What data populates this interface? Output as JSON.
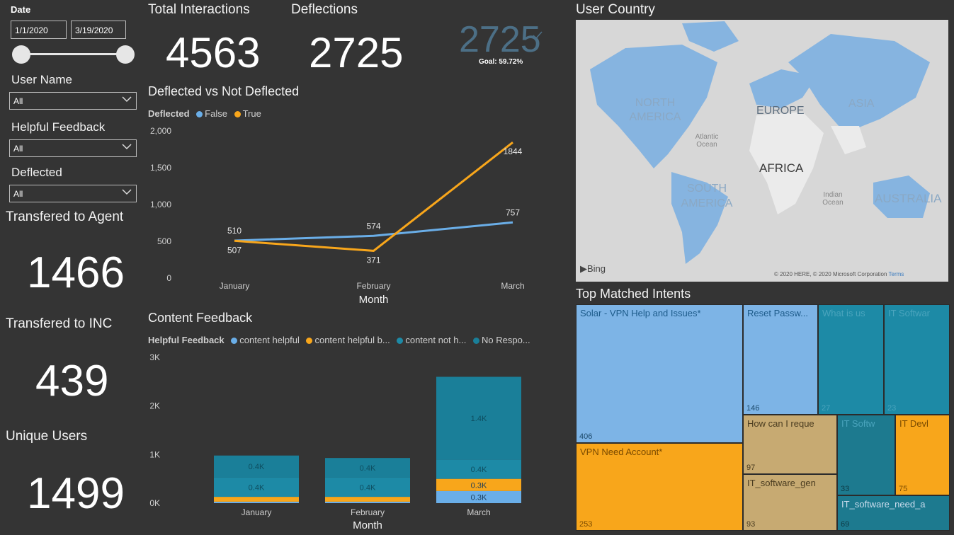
{
  "filters": {
    "date_label": "Date",
    "date_start": "1/1/2020",
    "date_end": "3/19/2020",
    "user_name": {
      "label": "User Name",
      "value": "All"
    },
    "helpful_feedback": {
      "label": "Helpful Feedback",
      "value": "All"
    },
    "deflected": {
      "label": "Deflected",
      "value": "All"
    }
  },
  "cards": {
    "transferred_agent": {
      "label": "Transfered to Agent",
      "value": "1466"
    },
    "transferred_inc": {
      "label": "Transfered to INC",
      "value": "439"
    },
    "unique_users": {
      "label": "Unique Users",
      "value": "1499"
    },
    "total_interactions": {
      "label": "Total Interactions",
      "value": "4563"
    },
    "deflections": {
      "label": "Deflections",
      "value": "2725"
    },
    "kpi": {
      "value": "2725",
      "goal": "Goal: 59.72%"
    }
  },
  "colors": {
    "blue": "#6aaee8",
    "orange": "#f8a61b",
    "teal": "#1d8aa6",
    "teal2": "#1a7f99"
  },
  "chart_data": [
    {
      "type": "line",
      "title": "Deflected vs Not Deflected",
      "legend_title": "Deflected",
      "xlabel": "Month",
      "ylabel": "",
      "categories": [
        "January",
        "February",
        "March"
      ],
      "ylim": [
        0,
        2000
      ],
      "yticks": [
        "0",
        "500",
        "1,000",
        "1,500",
        "2,000"
      ],
      "series": [
        {
          "name": "False",
          "values": [
            510,
            574,
            757
          ],
          "color": "#6aaee8"
        },
        {
          "name": "True",
          "values": [
            507,
            371,
            1844
          ],
          "color": "#f8a61b"
        }
      ],
      "data_labels": [
        "510",
        "507",
        "574",
        "371",
        "757",
        "1844"
      ]
    },
    {
      "type": "bar",
      "stacked": true,
      "title": "Content Feedback",
      "legend_title": "Helpful Feedback",
      "xlabel": "Month",
      "categories": [
        "January",
        "February",
        "March"
      ],
      "ylim": [
        0,
        3000
      ],
      "yticks": [
        "0K",
        "1K",
        "2K",
        "3K"
      ],
      "legend": [
        "content helpful",
        "content helpful b...",
        "content not h...",
        "No Respo..."
      ],
      "series": [
        {
          "name": "content helpful",
          "values": [
            30,
            30,
            250
          ],
          "color": "#6aaee8"
        },
        {
          "name": "content helpful b...",
          "values": [
            100,
            100,
            250
          ],
          "color": "#f8a61b"
        },
        {
          "name": "content not h...",
          "values": [
            400,
            400,
            400
          ],
          "color": "#1d8aa6"
        },
        {
          "name": "No Respo...",
          "values": [
            450,
            400,
            1700
          ],
          "color": "#1a7f99"
        }
      ],
      "data_labels": [
        [
          "0.4K",
          "0.4K"
        ],
        [
          "0.4K",
          "0.4K"
        ],
        [
          "0.3K",
          "0.3K",
          "0.4K",
          "1.4K"
        ]
      ]
    }
  ],
  "map": {
    "title": "User Country",
    "labels": [
      "NORTH AMERICA",
      "EUROPE",
      "ASIA",
      "AFRICA",
      "SOUTH AMERICA",
      "AUSTRALIA",
      "Atlantic Ocean",
      "Indian Ocean"
    ],
    "bing": "Bing",
    "copyright": "© 2020 HERE, © 2020 Microsoft Corporation",
    "terms": "Terms"
  },
  "treemap": {
    "title": "Top Matched Intents",
    "items": [
      {
        "label": "Solar - VPN Help and Issues*",
        "value": "406",
        "color": "#7db4e6"
      },
      {
        "label": "VPN Need Account*",
        "value": "253",
        "color": "#f8a61b"
      },
      {
        "label": "Reset Passw...",
        "value": "146",
        "color": "#7db4e6"
      },
      {
        "label": "What is us",
        "value": "27",
        "color": "#1d8aa6"
      },
      {
        "label": "IT Softwar",
        "value": "23",
        "color": "#1d8aa6"
      },
      {
        "label": "How can I reque",
        "value": "97",
        "color": "#c7aa72"
      },
      {
        "label": "IT Softw",
        "value": "33",
        "color": "#1d7a8f"
      },
      {
        "label": "IT Devl",
        "value": "75",
        "color": "#f8a61b"
      },
      {
        "label": "IT_software_gen",
        "value": "93",
        "color": "#c7aa72"
      },
      {
        "label": "IT_software_need_a",
        "value": "69",
        "color": "#1d7a8f"
      }
    ]
  }
}
